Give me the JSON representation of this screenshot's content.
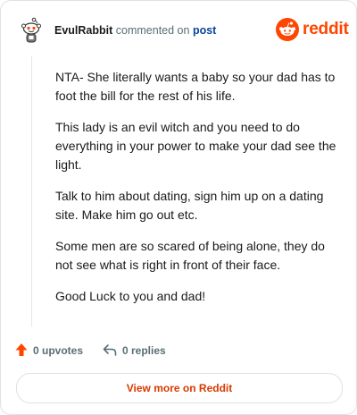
{
  "comment": {
    "username": "EvulRabbit",
    "commented_on_text": "commented on",
    "post_link": "post",
    "paragraphs": [
      "NTA- She literally wants a baby so your dad has to foot the bill for the rest of his life.",
      "This lady is an evil witch and you need to do everything in your power to make your dad see the light.",
      "Talk to him about dating, sign him up on a dating site. Make him go out etc.",
      "Some men are so scared of being alone, they do not see what is right in front of their face.",
      "Good Luck to you and dad!"
    ]
  },
  "brand": {
    "name": "reddit",
    "color": "#ff4500"
  },
  "actions": {
    "upvotes": "0 upvotes",
    "replies": "0 replies"
  },
  "footer": {
    "view_more": "View more on Reddit"
  },
  "icons": {
    "avatar": "snoo-avatar-icon",
    "logo": "reddit-logo-icon",
    "upvote": "upvote-arrow-icon",
    "reply": "reply-arrow-icon"
  }
}
